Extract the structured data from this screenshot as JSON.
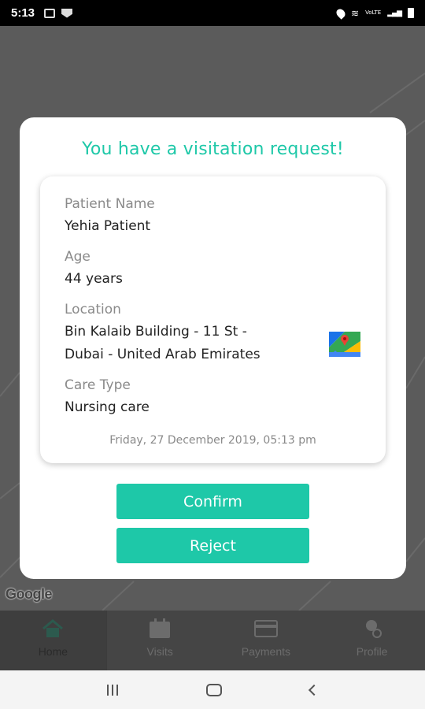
{
  "status_bar": {
    "time": "5:13",
    "right_text": "VoLTE"
  },
  "map": {
    "attribution": "Google"
  },
  "bottom_nav": {
    "items": [
      {
        "label": "Home"
      },
      {
        "label": "Visits"
      },
      {
        "label": "Payments"
      },
      {
        "label": "Profile"
      }
    ]
  },
  "modal": {
    "title": "You have a visitation request!",
    "patient_name_label": "Patient Name",
    "patient_name": "Yehia Patient",
    "age_label": "Age",
    "age": "44 years",
    "location_label": "Location",
    "location_line1": "Bin Kalaib Building - 11 St -",
    "location_line2": "Dubai - United Arab Emirates",
    "care_type_label": "Care Type",
    "care_type": "Nursing care",
    "datetime": "Friday, 27 December 2019, 05:13 pm",
    "confirm_label": "Confirm",
    "reject_label": "Reject"
  },
  "colors": {
    "accent": "#1ec8a8",
    "modal_bg": "#ffffff",
    "overlay": "#5b5b5b"
  }
}
